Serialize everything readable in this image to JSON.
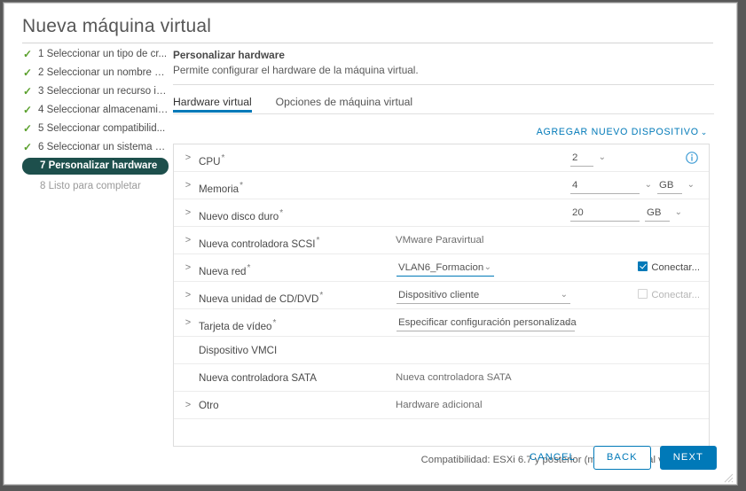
{
  "window": {
    "title": "Nueva máquina virtual"
  },
  "steps": [
    {
      "num": "1",
      "label": "1 Seleccionar un tipo de cr...",
      "state": "done"
    },
    {
      "num": "2",
      "label": "2 Seleccionar un nombre y ...",
      "state": "done"
    },
    {
      "num": "3",
      "label": "3 Seleccionar un recurso in...",
      "state": "done"
    },
    {
      "num": "4",
      "label": "4 Seleccionar almacenamie...",
      "state": "done"
    },
    {
      "num": "5",
      "label": "5 Seleccionar compatibilid...",
      "state": "done"
    },
    {
      "num": "6",
      "label": "6 Seleccionar un sistema o...",
      "state": "done"
    },
    {
      "num": "7",
      "label": "7 Personalizar hardware",
      "state": "current"
    },
    {
      "num": "8",
      "label": "8 Listo para completar",
      "state": "pending"
    }
  ],
  "pane": {
    "title": "Personalizar hardware",
    "subtitle": "Permite configurar el hardware de la máquina virtual."
  },
  "tabs": [
    {
      "label": "Hardware virtual",
      "active": true
    },
    {
      "label": "Opciones de máquina virtual",
      "active": false
    }
  ],
  "add_device": {
    "label": "AGREGAR NUEVO DISPOSITIVO",
    "caret": "⌄"
  },
  "hardware_rows": [
    {
      "label": "CPU",
      "required": true,
      "expandable": true,
      "field_value": "2",
      "field_kind": "select-narrow",
      "info_icon": "info-circle-icon"
    },
    {
      "label": "Memoria",
      "required": true,
      "expandable": true,
      "field_value": "4",
      "field_kind": "input-with-unit",
      "unit_value": "GB"
    },
    {
      "label": "Nuevo disco duro",
      "required": true,
      "expandable": true,
      "field_value": "20",
      "field_kind": "input-with-unit-plain",
      "unit_value": "GB"
    },
    {
      "label": "Nueva controladora SCSI",
      "required": true,
      "expandable": true,
      "static_value": "VMware Paravirtual"
    },
    {
      "label": "Nueva red",
      "required": true,
      "expandable": true,
      "field_value": "VLAN6_Formacion",
      "field_kind": "select-wide",
      "checkbox": {
        "label": "Conectar...",
        "checked": true,
        "disabled": false
      }
    },
    {
      "label": "Nueva unidad de CD/DVD",
      "required": true,
      "expandable": true,
      "field_value": "Dispositivo cliente",
      "field_kind": "select-wide2",
      "checkbox": {
        "label": "Conectar...",
        "checked": false,
        "disabled": true
      }
    },
    {
      "label": "Tarjeta de vídeo",
      "required": true,
      "expandable": true,
      "field_value": "Especificar configuración personalizada",
      "field_kind": "select-widest"
    },
    {
      "label": "Dispositivo VMCI",
      "required": false,
      "expandable": false
    },
    {
      "label": "Nueva controladora SATA",
      "required": false,
      "expandable": false,
      "static_value": "Nueva controladora SATA"
    },
    {
      "label": "Otro",
      "required": false,
      "expandable": true,
      "static_value": "Hardware adicional"
    }
  ],
  "compatibility": "Compatibilidad: ESXi 6.7 y posterior (máquina virtual versión 14)",
  "footer": {
    "cancel_label": "CANCEL",
    "back_label": "BACK",
    "next_label": "NEXT"
  },
  "colors": {
    "accent_blue": "#0079b8",
    "step_current_bg": "#1d4f4c",
    "tick_green": "#5aa02c"
  }
}
